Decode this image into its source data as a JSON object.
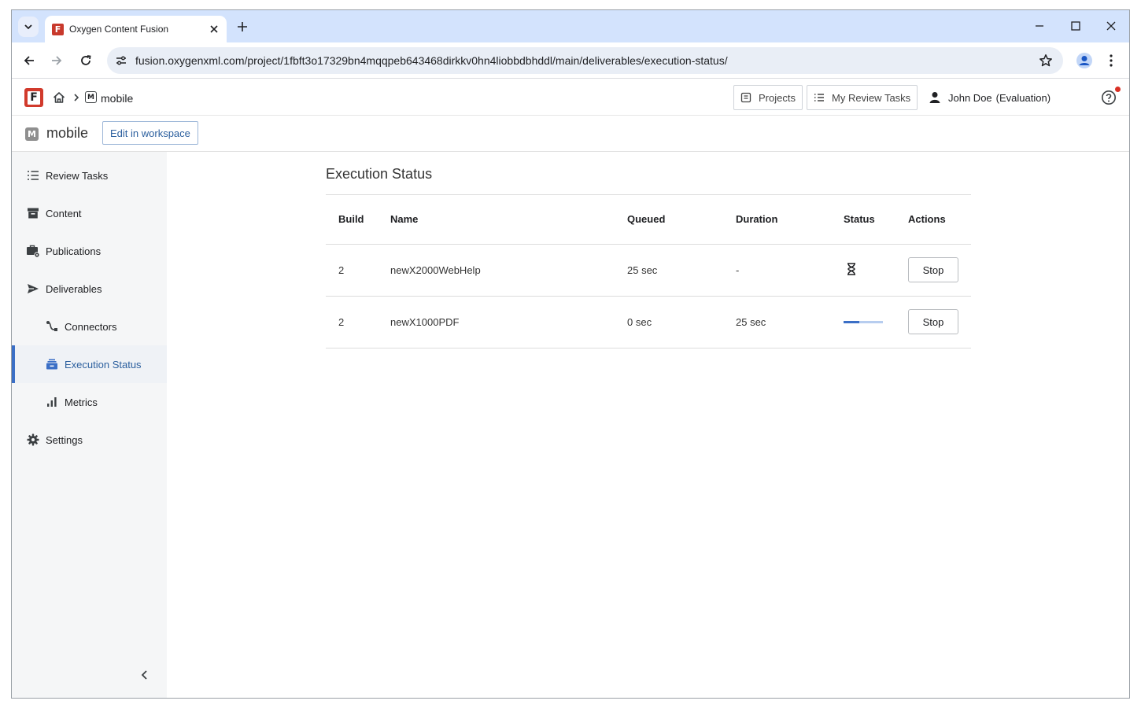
{
  "browser": {
    "tab_title": "Oxygen Content Fusion",
    "favicon_letter": "F",
    "url": "fusion.oxygenxml.com/project/1fbft3o17329bn4mqqpeb643468dirkkv0hn4liobbdbhddl/main/deliverables/execution-status/"
  },
  "header": {
    "logo_letter": "F",
    "breadcrumb": {
      "badge": "M",
      "label": "mobile"
    },
    "projects_label": "Projects",
    "review_tasks_label": "My Review Tasks",
    "user_name": "John Doe",
    "user_status": "(Evaluation)"
  },
  "project": {
    "badge": "M",
    "name": "mobile",
    "edit_label": "Edit in workspace"
  },
  "sidebar": {
    "items": [
      {
        "label": "Review Tasks",
        "icon": "list-icon"
      },
      {
        "label": "Content",
        "icon": "archive-box-icon"
      },
      {
        "label": "Publications",
        "icon": "briefcase-gear-icon"
      },
      {
        "label": "Deliverables",
        "icon": "send-icon"
      },
      {
        "label": "Connectors",
        "icon": "connector-icon"
      },
      {
        "label": "Execution Status",
        "icon": "execution-stack-icon",
        "active": true
      },
      {
        "label": "Metrics",
        "icon": "bar-chart-icon"
      },
      {
        "label": "Settings",
        "icon": "gear-icon"
      }
    ]
  },
  "main": {
    "title": "Execution Status",
    "columns": [
      "Build",
      "Name",
      "Queued",
      "Duration",
      "Status",
      "Actions"
    ],
    "rows": [
      {
        "build": "2",
        "name": "newX2000WebHelp",
        "queued": "25 sec",
        "duration": "-",
        "status": "queued",
        "action": "Stop"
      },
      {
        "build": "2",
        "name": "newX1000PDF",
        "queued": "0 sec",
        "duration": "25 sec",
        "status": "running",
        "progress": 0.4,
        "action": "Stop"
      }
    ]
  },
  "colors": {
    "accent": "#3b6fc6",
    "logo": "#d13a2c",
    "tabstrip": "#d3e3fd"
  }
}
